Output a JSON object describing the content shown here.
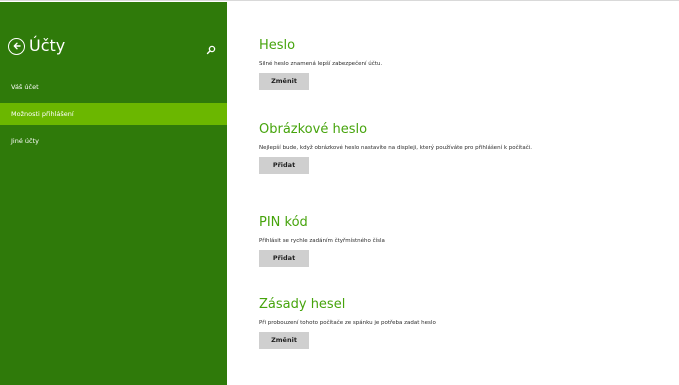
{
  "sidebar": {
    "title": "Účty",
    "back_icon": "back-arrow-icon",
    "search_icon": "search-icon",
    "items": [
      {
        "label": "Váš účet",
        "active": false
      },
      {
        "label": "Možnosti přihlášení",
        "active": true
      },
      {
        "label": "Jiné účty",
        "active": false
      }
    ]
  },
  "main": {
    "sections": [
      {
        "title": "Heslo",
        "description": "Silné heslo znamená lepší zabezpečení účtu.",
        "button": "Změnit"
      },
      {
        "title": "Obrázkové heslo",
        "description": "Nejlepší bude, když obrázkové heslo nastavíte na displeji, který používáte pro přihlášení k počítači.",
        "button": "Přidat"
      },
      {
        "title": "PIN kód",
        "description": "Přihlásit se rychle zadáním čtyřmístného čísla",
        "button": "Přidat"
      },
      {
        "title": "Zásady hesel",
        "description": "Při probouzení tohoto počítače ze spánku je potřeba zadat heslo",
        "button": "Změnit"
      }
    ]
  },
  "colors": {
    "sidebar_bg": "#2f7a0a",
    "active_item_bg": "#6bb700",
    "heading": "#46a40c",
    "button_bg": "#cfcfcf"
  }
}
